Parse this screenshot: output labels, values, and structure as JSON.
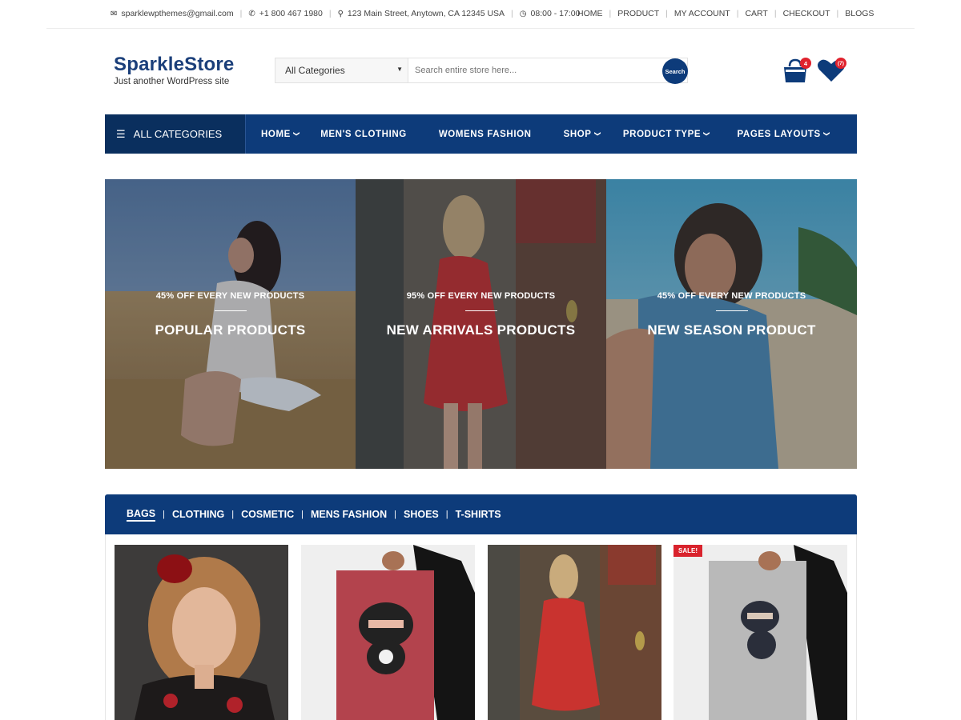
{
  "topbar": {
    "email": "sparklewpthemes@gmail.com",
    "phone": "+1 800 467 1980",
    "address": "123 Main Street, Anytown, CA 12345 USA",
    "hours": "08:00 - 17:00",
    "links": [
      "HOME",
      "PRODUCT",
      "MY ACCOUNT",
      "CART",
      "CHECKOUT",
      "BLOGS"
    ]
  },
  "header": {
    "site_title": "SparkleStore",
    "tagline": "Just another WordPress site",
    "search": {
      "category_selected": "All Categories",
      "placeholder": "Search entire store here...",
      "button_label": "Search"
    },
    "cart_count": "4",
    "wishlist_count": "(7)"
  },
  "nav": {
    "all_categories": "ALL CATEGORIES",
    "items": [
      {
        "label": "HOME",
        "dropdown": true
      },
      {
        "label": "MEN'S CLOTHING",
        "dropdown": false
      },
      {
        "label": "WOMENS FASHION",
        "dropdown": false
      },
      {
        "label": "SHOP",
        "dropdown": true
      },
      {
        "label": "PRODUCT TYPE",
        "dropdown": true
      },
      {
        "label": "PAGES LAYOUTS",
        "dropdown": true
      }
    ]
  },
  "banners": [
    {
      "subtitle": "45% OFF EVERY NEW PRODUCTS",
      "title": "POPULAR PRODUCTS"
    },
    {
      "subtitle": "95% OFF EVERY NEW PRODUCTS",
      "title": "NEW ARRIVALS PRODUCTS"
    },
    {
      "subtitle": "45% OFF EVERY NEW PRODUCTS",
      "title": "NEW SEASON PRODUCT"
    }
  ],
  "product_tabs": {
    "active": "BAGS",
    "items": [
      "BAGS",
      "CLOTHING",
      "COSMETIC",
      "MENS FASHION",
      "SHOES",
      "T-SHIRTS"
    ]
  },
  "products": [
    {
      "image": "woman-portrait-red-flower",
      "sale": false
    },
    {
      "image": "red-ninja-poster",
      "sale": false
    },
    {
      "image": "woman-red-dress",
      "sale": false
    },
    {
      "image": "grey-ninja-poster",
      "sale": true,
      "sale_label": "SALE!"
    }
  ],
  "colors": {
    "brand_blue": "#0d3b7a",
    "dark_blue": "#0a2f5e",
    "badge_red": "#e0222d"
  }
}
